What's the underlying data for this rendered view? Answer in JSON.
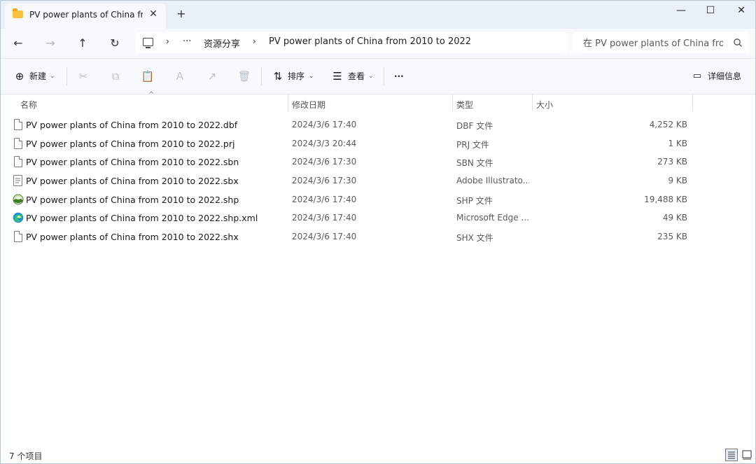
{
  "window": {
    "tab_title": "PV power plants of China from",
    "minimize": "—",
    "maximize": "☐",
    "close": "✕"
  },
  "address": {
    "more": "···",
    "crumbs": [
      "资源分享",
      "PV power plants of China from 2010 to 2022"
    ],
    "search_placeholder": "在 PV power plants of China from"
  },
  "toolbar": {
    "new_label": "新建",
    "sort_label": "排序",
    "view_label": "查看",
    "more_label": "···",
    "details_label": "详细信息"
  },
  "columns": {
    "name": "名称",
    "date": "修改日期",
    "type": "类型",
    "size": "大小"
  },
  "files": [
    {
      "name": "PV power plants of China from 2010 to 2022.dbf",
      "date": "2024/3/6 17:40",
      "type": "DBF 文件",
      "size": "4,252 KB",
      "icon": "file-icon"
    },
    {
      "name": "PV power plants of China from 2010 to 2022.prj",
      "date": "2024/3/3 20:44",
      "type": "PRJ 文件",
      "size": "1 KB",
      "icon": "file-icon"
    },
    {
      "name": "PV power plants of China from 2010 to 2022.sbn",
      "date": "2024/3/6 17:30",
      "type": "SBN 文件",
      "size": "273 KB",
      "icon": "file-icon"
    },
    {
      "name": "PV power plants of China from 2010 to 2022.sbx",
      "date": "2024/3/6 17:30",
      "type": "Adobe Illustrato...",
      "size": "9 KB",
      "icon": "text-file-icon"
    },
    {
      "name": "PV power plants of China from 2010 to 2022.shp",
      "date": "2024/3/6 17:40",
      "type": "SHP 文件",
      "size": "19,488 KB",
      "icon": "globe-icon"
    },
    {
      "name": "PV power plants of China from 2010 to 2022.shp.xml",
      "date": "2024/3/6 17:40",
      "type": "Microsoft Edge ...",
      "size": "49 KB",
      "icon": "edge-icon"
    },
    {
      "name": "PV power plants of China from 2010 to 2022.shx",
      "date": "2024/3/6 17:40",
      "type": "SHX 文件",
      "size": "235 KB",
      "icon": "file-icon"
    }
  ],
  "status": {
    "count": "7 个项目"
  },
  "colors": {
    "titlebar": "#eaf0f8",
    "toolbar": "#f7f9fc",
    "accent": "#0067c0"
  }
}
